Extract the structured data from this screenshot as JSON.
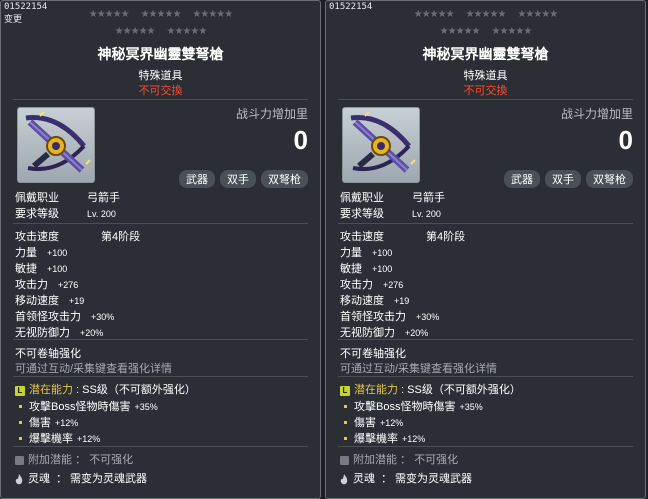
{
  "tooltips": [
    {
      "id_text": "01522154",
      "sub_text": "变更",
      "item_name": "神秘冥界幽靈雙弩槍",
      "item_type": "特殊道具",
      "trade_status": "不可交換",
      "stars_row1": [
        "★★★★★",
        "★★★★★",
        "★★★★★"
      ],
      "stars_row2": [
        "★★★★★",
        "★★★★★"
      ],
      "power_label": "战斗力增加里",
      "power_value": "0",
      "tags": [
        "武器",
        "双手",
        "双弩枪"
      ],
      "req_job_label": "佩戴职业",
      "req_job_value": "弓箭手",
      "req_level_label": "要求等级",
      "req_level_value": "Lv. 200",
      "attack_speed_label": "攻击速度",
      "attack_speed_value": "第4阶段",
      "stats": [
        {
          "label": "力量",
          "value": "+100"
        },
        {
          "label": "敏捷",
          "value": "+100"
        },
        {
          "label": "攻击力",
          "value": "+276"
        },
        {
          "label": "移动速度",
          "value": "+19"
        },
        {
          "label": "首领怪攻击力",
          "value": "+30%"
        },
        {
          "label": "无视防御力",
          "value": "+20%"
        }
      ],
      "upgrade_title": "不可卷轴强化",
      "upgrade_hint": "可通过互动/采集键查看强化详情",
      "potential_label": "潜在能力",
      "potential_grade": "SS级（不可额外强化）",
      "potential_lines": [
        {
          "label": "攻擊Boss怪物時傷害",
          "value": "+35%"
        },
        {
          "label": "傷害",
          "value": "+12%"
        },
        {
          "label": "爆擊機率",
          "value": "+12%"
        }
      ],
      "extra_potential": "附加潜能 ： 不可强化",
      "soul_label": "灵魂",
      "soul_value": "： 需变为灵魂武器"
    },
    {
      "id_text": "01522154",
      "item_name": "神秘冥界幽靈雙弩槍",
      "item_type": "特殊道具",
      "trade_status": "不可交換",
      "stars_row1": [
        "★★★★★",
        "★★★★★",
        "★★★★★"
      ],
      "stars_row2": [
        "★★★★★",
        "★★★★★"
      ],
      "power_label": "战斗力增加里",
      "power_value": "0",
      "tags": [
        "武器",
        "双手",
        "双弩枪"
      ],
      "req_job_label": "佩戴职业",
      "req_job_value": "弓箭手",
      "req_level_label": "要求等级",
      "req_level_value": "Lv. 200",
      "attack_speed_label": "攻击速度",
      "attack_speed_value": "第4阶段",
      "stats": [
        {
          "label": "力量",
          "value": "+100"
        },
        {
          "label": "敏捷",
          "value": "+100"
        },
        {
          "label": "攻击力",
          "value": "+276"
        },
        {
          "label": "移动速度",
          "value": "+19"
        },
        {
          "label": "首领怪攻击力",
          "value": "+30%"
        },
        {
          "label": "无视防御力",
          "value": "+20%"
        }
      ],
      "upgrade_title": "不可卷轴强化",
      "upgrade_hint": "可通过互动/采集键查看强化详情",
      "potential_label": "潜在能力",
      "potential_grade": "SS级（不可额外强化）",
      "potential_lines": [
        {
          "label": "攻擊Boss怪物時傷害",
          "value": "+35%"
        },
        {
          "label": "傷害",
          "value": "+12%"
        },
        {
          "label": "爆擊機率",
          "value": "+12%"
        }
      ],
      "extra_potential": "附加潜能 ： 不可强化",
      "soul_label": "灵魂",
      "soul_value": "： 需变为灵魂武器"
    }
  ],
  "colors": {
    "panel_bg": "#2b2f35",
    "untradeable": "#ff4a2a",
    "potential": "#e5c64a",
    "muted": "#a7abb0"
  },
  "icons": {
    "potential_badge": "potential-L-icon",
    "extra_potential": "locked-square-icon",
    "soul": "flame-icon",
    "item": "crossbow-icon"
  }
}
